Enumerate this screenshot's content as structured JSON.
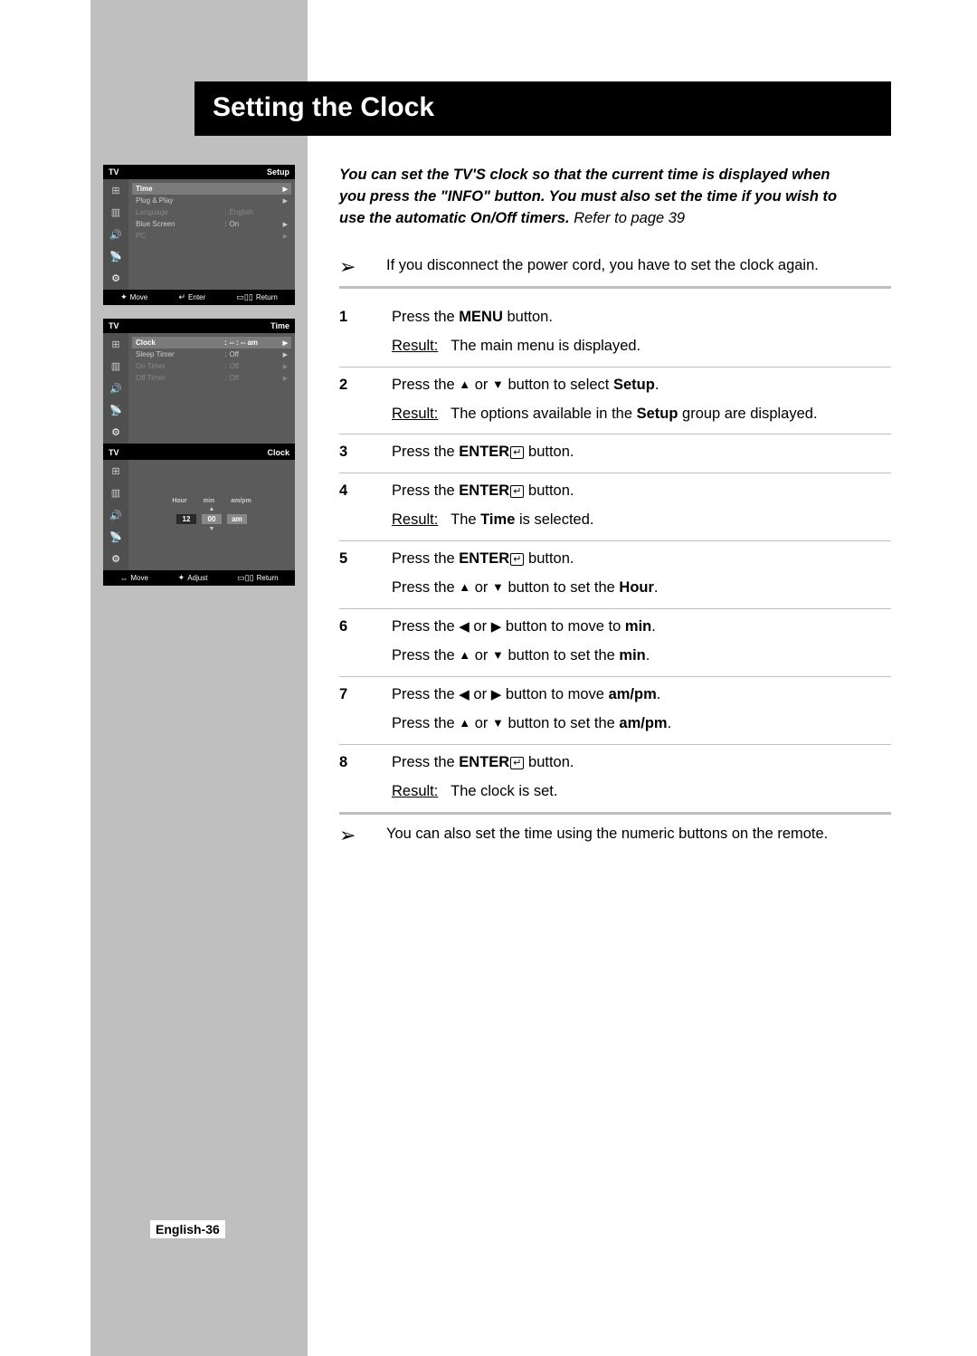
{
  "page_title": "Setting the Clock",
  "page_number": "English-36",
  "intro": {
    "line1": "You can set the TV'S clock so that the current time is displayed when",
    "line2": "you press the \"INFO\" button. You must also set the time if you wish to",
    "line3": "use the automatic On/Off timers.",
    "refer": "Refer to page 39"
  },
  "note_top": "If you disconnect the power cord, you have to set the clock again.",
  "note_bottom": "You can also set the time using the numeric buttons on the remote.",
  "osd": {
    "shared": {
      "tv": "TV",
      "foot_move": "Move",
      "foot_enter": "Enter",
      "foot_adjust": "Adjust",
      "foot_return": "Return"
    },
    "setup": {
      "title": "Setup",
      "rows": {
        "time": {
          "label": "Time",
          "val": ""
        },
        "plug": {
          "label": "Plug & Play",
          "val": ""
        },
        "language": {
          "label": "Language",
          "val": "English"
        },
        "bluescreen": {
          "label": "Blue Screen",
          "val": "On"
        },
        "pc": {
          "label": "PC",
          "val": ""
        }
      }
    },
    "time": {
      "title": "Time",
      "rows": {
        "clock": {
          "label": "Clock",
          "val": "-- : -- am"
        },
        "sleep": {
          "label": "Sleep Timer",
          "val": "Off"
        },
        "ontimer": {
          "label": "On Timer",
          "val": "Off"
        },
        "offtimer": {
          "label": "Off Timer",
          "val": "Off"
        }
      }
    },
    "clock": {
      "title": "Clock",
      "labels": {
        "hour": "Hour",
        "min": "min",
        "ampm": "am/pm"
      },
      "vals": {
        "hour": "12",
        "min": "00",
        "ampm": "am"
      }
    }
  },
  "steps": {
    "s1": {
      "num": "1",
      "t1a": "Press the ",
      "t1b": "MENU",
      "t1c": " button.",
      "r": "Result:",
      "rt": "The main menu is displayed."
    },
    "s2": {
      "num": "2",
      "t1a": "Press the ",
      "t1b": " button to select ",
      "t1c": "Setup",
      "t1d": ".",
      "r": "Result:",
      "rt_a": "The options available in the ",
      "rt_b": "Setup",
      "rt_c": " group are displayed."
    },
    "s3": {
      "num": "3",
      "t1a": "Press the ",
      "t1b": "ENTER",
      "t1c": " button."
    },
    "s4": {
      "num": "4",
      "t1a": "Press the ",
      "t1b": "ENTER",
      "t1c": " button.",
      "r": "Result:",
      "rt_a": "The ",
      "rt_b": "Time",
      "rt_c": " is selected."
    },
    "s5": {
      "num": "5",
      "t1a": "Press the ",
      "t1b": "ENTER",
      "t1c": " button.",
      "t2a": "Press the ",
      "t2b": " button to set the ",
      "t2c": "Hour",
      "t2d": "."
    },
    "s6": {
      "num": "6",
      "t1a": "Press the ",
      "t1b": " button to move to ",
      "t1c": "min",
      "t1d": ".",
      "t2a": "Press the ",
      "t2b": " button to set the ",
      "t2c": "min",
      "t2d": "."
    },
    "s7": {
      "num": "7",
      "t1a": "Press the ",
      "t1b": " button to move ",
      "t1c": "am/pm",
      "t1d": ".",
      "t2a": "Press the ",
      "t2b": " button to set the ",
      "t2c": "am/pm",
      "t2d": "."
    },
    "s8": {
      "num": "8",
      "t1a": "Press the ",
      "t1b": "ENTER",
      "t1c": " button.",
      "r": "Result:",
      "rt": "The clock is set."
    }
  },
  "glyph": {
    "or": " or ",
    "up": "▲",
    "down": "▼",
    "left": "◀",
    "right": "▶",
    "enter": "↵",
    "note_mark": "➢",
    "move_ud": "✦",
    "move_lr": "⇔",
    "adjust": "✦",
    "return": "▭▯▯"
  }
}
